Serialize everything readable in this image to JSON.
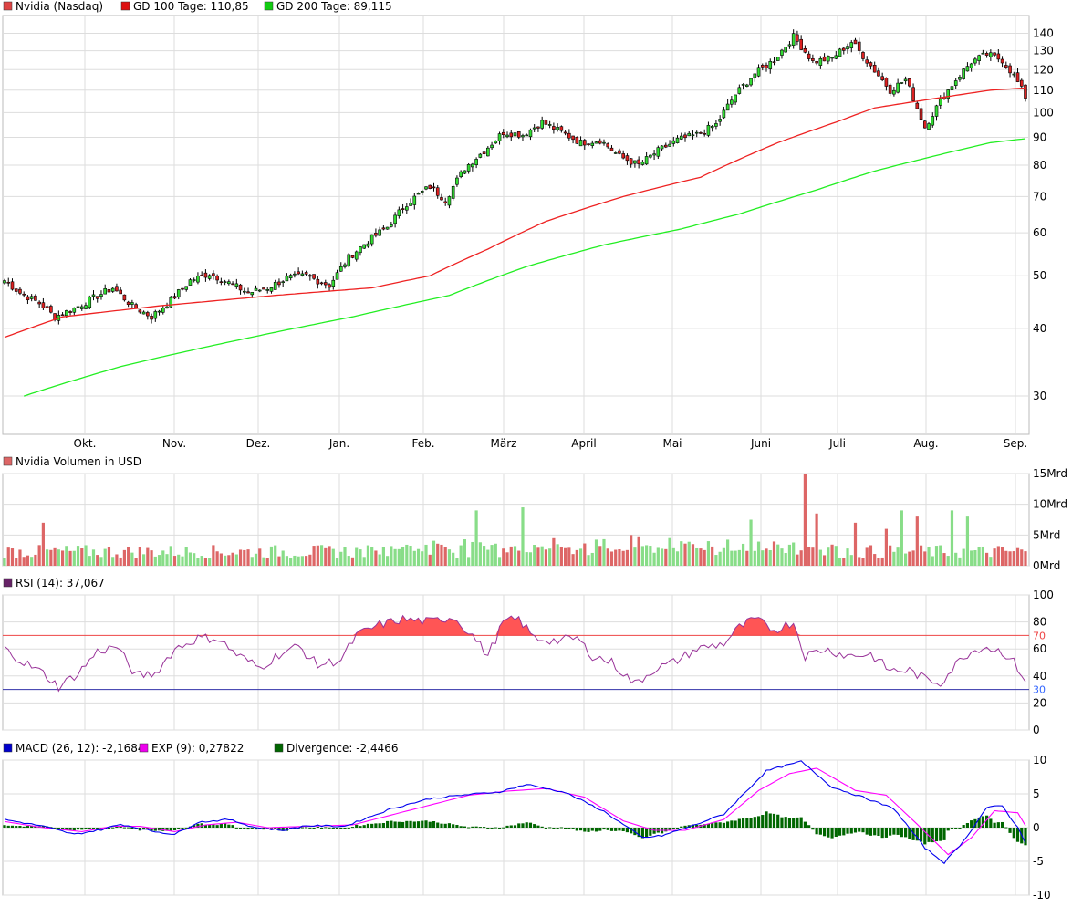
{
  "colors": {
    "candle_up": "#33dd33",
    "candle_down": "#dd2222",
    "ma100": "#ee2222",
    "ma200": "#22ee22",
    "volume_up": "#88dd88",
    "volume_down": "#dd6666",
    "rsi_line": "#993399",
    "rsi_fill": "#ff5555",
    "rsi_70": "#ee4444",
    "rsi_30": "#3333aa",
    "macd": "#0000ee",
    "exp": "#ff00ff",
    "divergence": "#006600",
    "grid": "#dddddd",
    "border": "#bbbbbb"
  },
  "chart_data": [
    {
      "type": "candlestick",
      "legend": [
        {
          "label": "Nvidia (Nasdaq)",
          "color": "#dd4444"
        },
        {
          "label": "GD 100 Tage: 110,85",
          "color": "#dd1111"
        },
        {
          "label": "GD 200 Tage: 89,115",
          "color": "#11cc11"
        }
      ],
      "scale": "log",
      "y_ticks": [
        30,
        40,
        50,
        60,
        70,
        80,
        90,
        100,
        110,
        120,
        130,
        140
      ],
      "ylim": [
        25.5,
        151
      ],
      "x_ticks": [
        "Okt.",
        "Nov.",
        "Dez.",
        "Jan.",
        "Feb.",
        "März",
        "April",
        "Mai",
        "Juni",
        "Juli",
        "Aug.",
        "Sep."
      ],
      "close_anchors": [
        [
          0,
          49
        ],
        [
          4,
          46.5
        ],
        [
          9,
          44.5
        ],
        [
          13,
          42
        ],
        [
          18,
          43.5
        ],
        [
          23,
          45.5
        ],
        [
          28,
          47.5
        ],
        [
          33,
          44
        ],
        [
          38,
          42
        ],
        [
          43,
          45
        ],
        [
          48,
          49
        ],
        [
          53,
          50.5
        ],
        [
          58,
          48.5
        ],
        [
          63,
          46.5
        ],
        [
          68,
          47.5
        ],
        [
          73,
          49.5
        ],
        [
          78,
          50
        ],
        [
          84,
          48
        ],
        [
          89,
          54
        ],
        [
          94,
          58
        ],
        [
          99,
          61.5
        ],
        [
          104,
          68
        ],
        [
          110,
          73
        ],
        [
          114,
          69
        ],
        [
          119,
          79
        ],
        [
          124,
          85
        ],
        [
          129,
          92
        ],
        [
          134,
          91
        ],
        [
          139,
          96
        ],
        [
          144,
          92
        ],
        [
          149,
          88
        ],
        [
          154,
          89
        ],
        [
          159,
          83
        ],
        [
          164,
          80
        ],
        [
          169,
          85
        ],
        [
          174,
          89
        ],
        [
          179,
          91
        ],
        [
          184,
          95
        ],
        [
          189,
          108
        ],
        [
          194,
          118
        ],
        [
          199,
          125
        ],
        [
          204,
          138
        ],
        [
          209,
          124
        ],
        [
          214,
          126
        ],
        [
          219,
          135
        ],
        [
          224,
          122
        ],
        [
          229,
          110
        ],
        [
          233,
          115
        ],
        [
          236,
          102
        ],
        [
          238,
          94
        ],
        [
          242,
          105
        ],
        [
          246,
          115
        ],
        [
          250,
          124
        ],
        [
          254,
          128
        ],
        [
          258,
          125
        ],
        [
          261,
          117
        ],
        [
          264,
          107
        ]
      ],
      "ma100_anchors": [
        [
          0,
          38.5
        ],
        [
          15,
          42
        ],
        [
          40,
          44
        ],
        [
          70,
          46
        ],
        [
          95,
          47.5
        ],
        [
          110,
          50
        ],
        [
          125,
          56
        ],
        [
          140,
          63
        ],
        [
          160,
          70
        ],
        [
          180,
          76
        ],
        [
          190,
          82
        ],
        [
          200,
          88
        ],
        [
          215,
          96
        ],
        [
          225,
          102
        ],
        [
          240,
          106
        ],
        [
          255,
          110
        ],
        [
          264,
          111
        ]
      ],
      "ma200_anchors": [
        [
          5,
          30
        ],
        [
          30,
          34
        ],
        [
          60,
          38
        ],
        [
          90,
          42
        ],
        [
          115,
          46
        ],
        [
          135,
          52
        ],
        [
          155,
          57
        ],
        [
          175,
          61
        ],
        [
          190,
          65
        ],
        [
          210,
          72
        ],
        [
          225,
          78
        ],
        [
          240,
          83
        ],
        [
          255,
          88
        ],
        [
          264,
          89.5
        ]
      ]
    },
    {
      "type": "bar",
      "legend": [
        {
          "label": "Nvidia Volumen in USD",
          "color": "#dd6666"
        }
      ],
      "y_ticks_labels": [
        "0Mrd",
        "5Mrd",
        "10Mrd",
        "15Mrd"
      ],
      "y_ticks": [
        0,
        5,
        10,
        15
      ],
      "ylim": [
        0,
        15
      ],
      "spikes": [
        [
          10,
          7
        ],
        [
          122,
          9
        ],
        [
          134,
          9.5
        ],
        [
          193,
          7.5
        ],
        [
          207,
          15
        ],
        [
          162,
          5
        ],
        [
          172,
          4.5
        ],
        [
          182,
          4
        ],
        [
          210,
          8.5
        ],
        [
          220,
          7
        ],
        [
          228,
          6
        ],
        [
          232,
          9
        ],
        [
          236,
          8
        ],
        [
          245,
          9
        ],
        [
          249,
          8
        ]
      ]
    },
    {
      "type": "line",
      "legend": [
        {
          "label": "RSI (14): 37,067",
          "color": "#662266"
        }
      ],
      "y_ticks": [
        0,
        20,
        40,
        60,
        80,
        100
      ],
      "ylim": [
        0,
        100
      ],
      "levels": [
        {
          "value": 70,
          "label": "70"
        },
        {
          "value": 30,
          "label": "30"
        }
      ],
      "anchors": [
        [
          0,
          60
        ],
        [
          5,
          50
        ],
        [
          10,
          42
        ],
        [
          14,
          32
        ],
        [
          19,
          42
        ],
        [
          24,
          58
        ],
        [
          29,
          62
        ],
        [
          34,
          40
        ],
        [
          39,
          42
        ],
        [
          44,
          60
        ],
        [
          50,
          68
        ],
        [
          55,
          68
        ],
        [
          60,
          56
        ],
        [
          66,
          46
        ],
        [
          71,
          56
        ],
        [
          76,
          62
        ],
        [
          81,
          48
        ],
        [
          87,
          52
        ],
        [
          91,
          70
        ],
        [
          97,
          78
        ],
        [
          103,
          82
        ],
        [
          110,
          80
        ],
        [
          116,
          84
        ],
        [
          121,
          70
        ],
        [
          125,
          55
        ],
        [
          129,
          80
        ],
        [
          133,
          82
        ],
        [
          137,
          68
        ],
        [
          143,
          66
        ],
        [
          148,
          68
        ],
        [
          152,
          55
        ],
        [
          157,
          50
        ],
        [
          163,
          34
        ],
        [
          168,
          45
        ],
        [
          173,
          50
        ],
        [
          179,
          60
        ],
        [
          186,
          64
        ],
        [
          190,
          76
        ],
        [
          194,
          82
        ],
        [
          199,
          74
        ],
        [
          204,
          80
        ],
        [
          207,
          55
        ],
        [
          212,
          60
        ],
        [
          218,
          55
        ],
        [
          224,
          56
        ],
        [
          229,
          44
        ],
        [
          234,
          44
        ],
        [
          238,
          38
        ],
        [
          242,
          35
        ],
        [
          248,
          55
        ],
        [
          253,
          62
        ],
        [
          258,
          58
        ],
        [
          261,
          50
        ],
        [
          264,
          37
        ]
      ]
    },
    {
      "type": "line",
      "legend": [
        {
          "label": "MACD (26, 12): -2,1684",
          "color": "#0000cc"
        },
        {
          "label": "EXP (9): 0,27822",
          "color": "#ee00ee"
        },
        {
          "label": "Divergence: -2,4466",
          "color": "#006600"
        }
      ],
      "y_ticks": [
        -10,
        -5,
        0,
        5,
        10
      ],
      "ylim": [
        -10,
        10
      ],
      "macd_anchors": [
        [
          0,
          1.2
        ],
        [
          10,
          0.2
        ],
        [
          18,
          -1.0
        ],
        [
          25,
          -0.3
        ],
        [
          30,
          0.5
        ],
        [
          38,
          -0.5
        ],
        [
          44,
          -1.0
        ],
        [
          50,
          0.8
        ],
        [
          58,
          1.2
        ],
        [
          65,
          0.0
        ],
        [
          72,
          -0.4
        ],
        [
          78,
          0.3
        ],
        [
          88,
          0.2
        ],
        [
          100,
          2.8
        ],
        [
          110,
          4.3
        ],
        [
          120,
          4.9
        ],
        [
          128,
          5.3
        ],
        [
          135,
          6.4
        ],
        [
          145,
          5.2
        ],
        [
          155,
          2.4
        ],
        [
          165,
          -1.5
        ],
        [
          170,
          -1.2
        ],
        [
          178,
          0.3
        ],
        [
          186,
          2.0
        ],
        [
          192,
          5.5
        ],
        [
          197,
          8.4
        ],
        [
          206,
          9.8
        ],
        [
          214,
          6.0
        ],
        [
          222,
          4.5
        ],
        [
          230,
          2.8
        ],
        [
          238,
          -3.0
        ],
        [
          243,
          -5.2
        ],
        [
          248,
          -2.0
        ],
        [
          254,
          3.0
        ],
        [
          258,
          3.2
        ],
        [
          262,
          0.0
        ],
        [
          264,
          -2.2
        ]
      ],
      "exp_anchors": [
        [
          0,
          0.9
        ],
        [
          10,
          0.0
        ],
        [
          20,
          -0.6
        ],
        [
          28,
          0.2
        ],
        [
          35,
          0.2
        ],
        [
          44,
          -0.6
        ],
        [
          52,
          0.4
        ],
        [
          60,
          0.8
        ],
        [
          68,
          0.0
        ],
        [
          78,
          0.2
        ],
        [
          90,
          0.4
        ],
        [
          105,
          2.6
        ],
        [
          120,
          4.8
        ],
        [
          130,
          5.4
        ],
        [
          140,
          5.8
        ],
        [
          150,
          4.5
        ],
        [
          160,
          1.0
        ],
        [
          168,
          -0.4
        ],
        [
          176,
          -0.4
        ],
        [
          186,
          1.2
        ],
        [
          195,
          5.5
        ],
        [
          203,
          8.0
        ],
        [
          210,
          8.8
        ],
        [
          220,
          5.5
        ],
        [
          228,
          4.8
        ],
        [
          236,
          0.5
        ],
        [
          244,
          -4.0
        ],
        [
          250,
          -1.5
        ],
        [
          256,
          2.5
        ],
        [
          262,
          2.2
        ],
        [
          264,
          0.3
        ]
      ]
    }
  ]
}
